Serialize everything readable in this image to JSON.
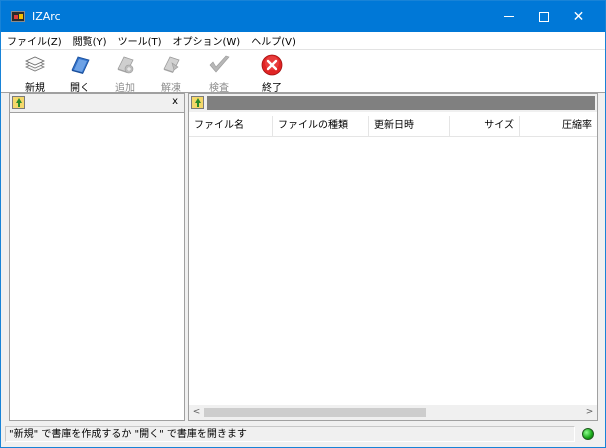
{
  "window": {
    "title": "IZArc"
  },
  "menu": [
    {
      "label": "ファイル(Z)"
    },
    {
      "label": "閲覧(Y)"
    },
    {
      "label": "ツール(T)"
    },
    {
      "label": "オプション(W)"
    },
    {
      "label": "ヘルプ(V)"
    }
  ],
  "toolbar": {
    "new_label": "新規",
    "open_label": "開く",
    "add_label": "追加",
    "extract_label": "解凍",
    "test_label": "検査",
    "exit_label": "終了"
  },
  "left_pane": {
    "close_label": "x"
  },
  "file_list": {
    "columns": [
      {
        "label": "ファイル名"
      },
      {
        "label": "ファイルの種類"
      },
      {
        "label": "更新日時"
      },
      {
        "label": "サイズ"
      },
      {
        "label": "圧縮率"
      }
    ],
    "rows": []
  },
  "status": {
    "text": "\"新規\" で書庫を作成するか \"開く\" で書庫を開きます",
    "indicator_color": "#17a617"
  },
  "colors": {
    "titlebar": "#0078d7"
  }
}
